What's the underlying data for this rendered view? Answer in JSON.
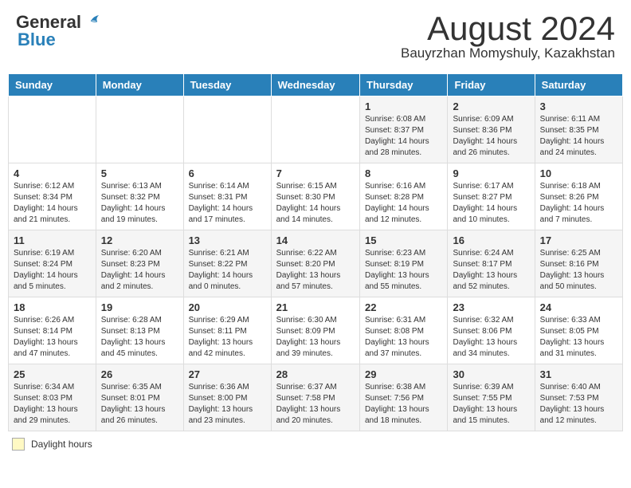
{
  "header": {
    "logo_line1": "General",
    "logo_line2": "Blue",
    "title": "August 2024",
    "subtitle": "Bauyrzhan Momyshuly, Kazakhstan"
  },
  "calendar": {
    "days_of_week": [
      "Sunday",
      "Monday",
      "Tuesday",
      "Wednesday",
      "Thursday",
      "Friday",
      "Saturday"
    ],
    "weeks": [
      [
        {
          "day": "",
          "info": ""
        },
        {
          "day": "",
          "info": ""
        },
        {
          "day": "",
          "info": ""
        },
        {
          "day": "",
          "info": ""
        },
        {
          "day": "1",
          "info": "Sunrise: 6:08 AM\nSunset: 8:37 PM\nDaylight: 14 hours and 28 minutes."
        },
        {
          "day": "2",
          "info": "Sunrise: 6:09 AM\nSunset: 8:36 PM\nDaylight: 14 hours and 26 minutes."
        },
        {
          "day": "3",
          "info": "Sunrise: 6:11 AM\nSunset: 8:35 PM\nDaylight: 14 hours and 24 minutes."
        }
      ],
      [
        {
          "day": "4",
          "info": "Sunrise: 6:12 AM\nSunset: 8:34 PM\nDaylight: 14 hours and 21 minutes."
        },
        {
          "day": "5",
          "info": "Sunrise: 6:13 AM\nSunset: 8:32 PM\nDaylight: 14 hours and 19 minutes."
        },
        {
          "day": "6",
          "info": "Sunrise: 6:14 AM\nSunset: 8:31 PM\nDaylight: 14 hours and 17 minutes."
        },
        {
          "day": "7",
          "info": "Sunrise: 6:15 AM\nSunset: 8:30 PM\nDaylight: 14 hours and 14 minutes."
        },
        {
          "day": "8",
          "info": "Sunrise: 6:16 AM\nSunset: 8:28 PM\nDaylight: 14 hours and 12 minutes."
        },
        {
          "day": "9",
          "info": "Sunrise: 6:17 AM\nSunset: 8:27 PM\nDaylight: 14 hours and 10 minutes."
        },
        {
          "day": "10",
          "info": "Sunrise: 6:18 AM\nSunset: 8:26 PM\nDaylight: 14 hours and 7 minutes."
        }
      ],
      [
        {
          "day": "11",
          "info": "Sunrise: 6:19 AM\nSunset: 8:24 PM\nDaylight: 14 hours and 5 minutes."
        },
        {
          "day": "12",
          "info": "Sunrise: 6:20 AM\nSunset: 8:23 PM\nDaylight: 14 hours and 2 minutes."
        },
        {
          "day": "13",
          "info": "Sunrise: 6:21 AM\nSunset: 8:22 PM\nDaylight: 14 hours and 0 minutes."
        },
        {
          "day": "14",
          "info": "Sunrise: 6:22 AM\nSunset: 8:20 PM\nDaylight: 13 hours and 57 minutes."
        },
        {
          "day": "15",
          "info": "Sunrise: 6:23 AM\nSunset: 8:19 PM\nDaylight: 13 hours and 55 minutes."
        },
        {
          "day": "16",
          "info": "Sunrise: 6:24 AM\nSunset: 8:17 PM\nDaylight: 13 hours and 52 minutes."
        },
        {
          "day": "17",
          "info": "Sunrise: 6:25 AM\nSunset: 8:16 PM\nDaylight: 13 hours and 50 minutes."
        }
      ],
      [
        {
          "day": "18",
          "info": "Sunrise: 6:26 AM\nSunset: 8:14 PM\nDaylight: 13 hours and 47 minutes."
        },
        {
          "day": "19",
          "info": "Sunrise: 6:28 AM\nSunset: 8:13 PM\nDaylight: 13 hours and 45 minutes."
        },
        {
          "day": "20",
          "info": "Sunrise: 6:29 AM\nSunset: 8:11 PM\nDaylight: 13 hours and 42 minutes."
        },
        {
          "day": "21",
          "info": "Sunrise: 6:30 AM\nSunset: 8:09 PM\nDaylight: 13 hours and 39 minutes."
        },
        {
          "day": "22",
          "info": "Sunrise: 6:31 AM\nSunset: 8:08 PM\nDaylight: 13 hours and 37 minutes."
        },
        {
          "day": "23",
          "info": "Sunrise: 6:32 AM\nSunset: 8:06 PM\nDaylight: 13 hours and 34 minutes."
        },
        {
          "day": "24",
          "info": "Sunrise: 6:33 AM\nSunset: 8:05 PM\nDaylight: 13 hours and 31 minutes."
        }
      ],
      [
        {
          "day": "25",
          "info": "Sunrise: 6:34 AM\nSunset: 8:03 PM\nDaylight: 13 hours and 29 minutes."
        },
        {
          "day": "26",
          "info": "Sunrise: 6:35 AM\nSunset: 8:01 PM\nDaylight: 13 hours and 26 minutes."
        },
        {
          "day": "27",
          "info": "Sunrise: 6:36 AM\nSunset: 8:00 PM\nDaylight: 13 hours and 23 minutes."
        },
        {
          "day": "28",
          "info": "Sunrise: 6:37 AM\nSunset: 7:58 PM\nDaylight: 13 hours and 20 minutes."
        },
        {
          "day": "29",
          "info": "Sunrise: 6:38 AM\nSunset: 7:56 PM\nDaylight: 13 hours and 18 minutes."
        },
        {
          "day": "30",
          "info": "Sunrise: 6:39 AM\nSunset: 7:55 PM\nDaylight: 13 hours and 15 minutes."
        },
        {
          "day": "31",
          "info": "Sunrise: 6:40 AM\nSunset: 7:53 PM\nDaylight: 13 hours and 12 minutes."
        }
      ]
    ]
  },
  "footer": {
    "legend_label": "Daylight hours"
  }
}
